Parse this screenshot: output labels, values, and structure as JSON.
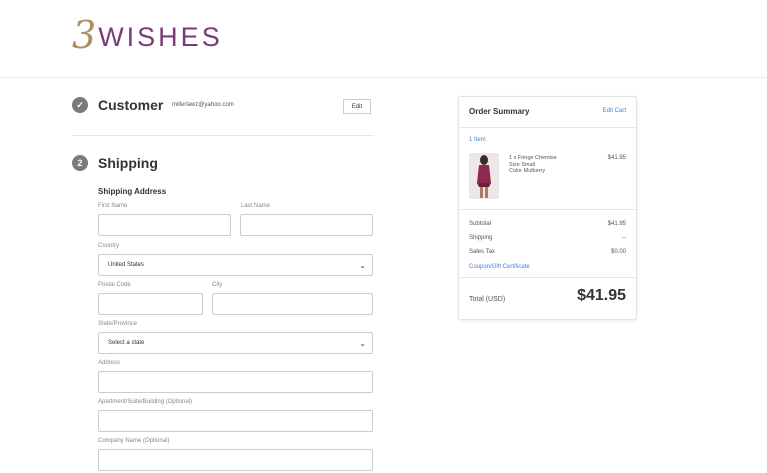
{
  "logo": {
    "numeral": "3",
    "word": "WISHES",
    "colors": {
      "numeral": "#b08d5a",
      "word": "#7a3b78"
    }
  },
  "customer": {
    "title": "Customer",
    "email": "millerlawz@yahoo.com",
    "edit_label": "Edit",
    "icon": "check-icon"
  },
  "shipping": {
    "step": "2",
    "title": "Shipping",
    "section_title": "Shipping Address",
    "labels": {
      "first_name": "First Name",
      "last_name": "Last Name",
      "country": "Country",
      "postal_code": "Postal Code",
      "city": "City",
      "state": "State/Province",
      "address": "Address",
      "apartment": "Apartment/Suite/Building (Optional)",
      "company": "Company Name (Optional)"
    },
    "values": {
      "country": "United States",
      "state": "Select a state"
    }
  },
  "summary": {
    "title": "Order Summary",
    "edit_cart": "Edit Cart",
    "items_count": "1 Item",
    "item": {
      "name": "1 x Fringe Chemise",
      "size": "Size Small",
      "color": "Color Mulberry",
      "price": "$41.95"
    },
    "subtotal_label": "Subtotal",
    "subtotal": "$41.95",
    "shipping_label": "Shipping",
    "shipping": "--",
    "tax_label": "Sales Tax",
    "tax": "$0.00",
    "coupon": "Coupon/Gift Certificate",
    "total_label": "Total (USD)",
    "total": "$41.95"
  },
  "colors": {
    "link": "#4a7fd6",
    "step_icon": "#7a7a7a"
  }
}
